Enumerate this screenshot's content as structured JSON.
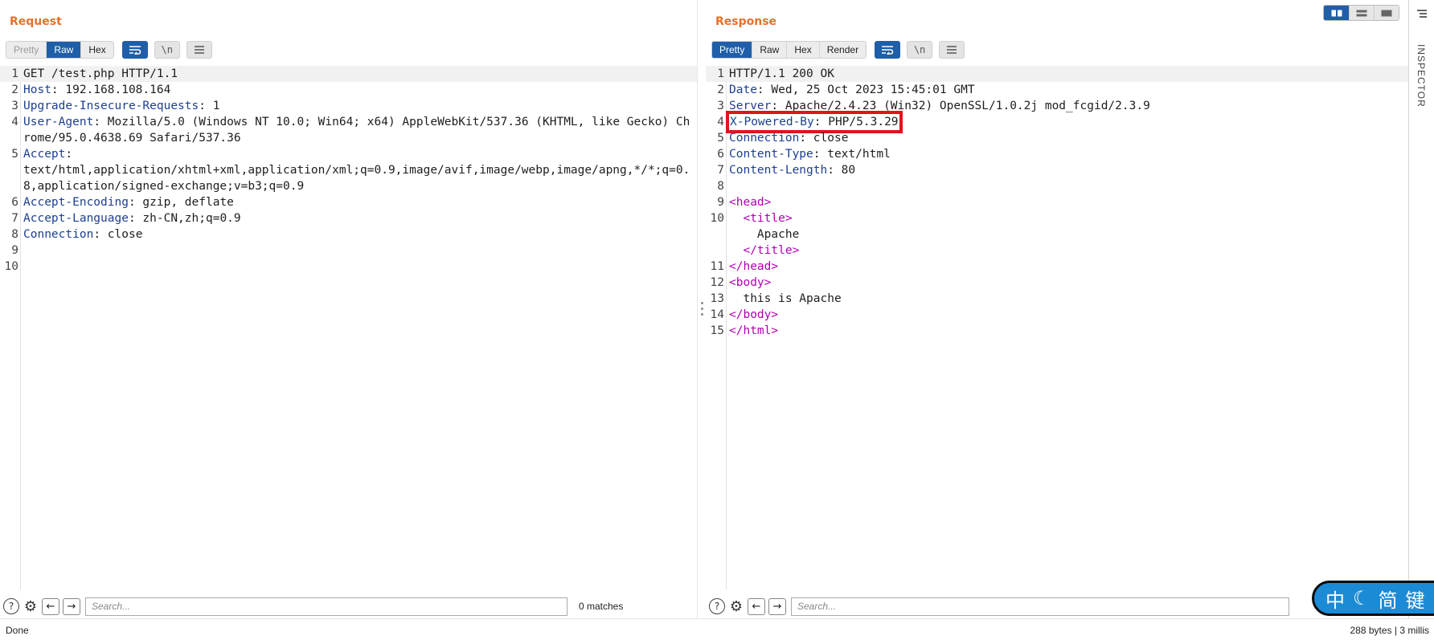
{
  "request": {
    "title": "Request",
    "tabs": [
      "Pretty",
      "Raw",
      "Hex"
    ],
    "newline_label": "\\n",
    "lines": [
      {
        "n": "1",
        "key": "",
        "val": "GET /test.php HTTP/1.1"
      },
      {
        "n": "2",
        "key": "Host",
        "val": ": 192.168.108.164"
      },
      {
        "n": "3",
        "key": "Upgrade-Insecure-Requests",
        "val": ": 1"
      },
      {
        "n": "4",
        "key": "User-Agent",
        "val": ": Mozilla/5.0 (Windows NT 10.0; Win64; x64) AppleWebKit/537.36 (KHTML, like Gecko) Chrome/95.0.4638.69 Safari/537.36"
      },
      {
        "n": "5",
        "key": "Accept",
        "val": ":\ntext/html,application/xhtml+xml,application/xml;q=0.9,image/avif,image/webp,image/apng,*/*;q=0.8,application/signed-exchange;v=b3;q=0.9"
      },
      {
        "n": "6",
        "key": "Accept-Encoding",
        "val": ": gzip, deflate"
      },
      {
        "n": "7",
        "key": "Accept-Language",
        "val": ": zh-CN,zh;q=0.9"
      },
      {
        "n": "8",
        "key": "Connection",
        "val": ": close"
      },
      {
        "n": "9",
        "key": "",
        "val": ""
      },
      {
        "n": "10",
        "key": "",
        "val": ""
      }
    ],
    "search_placeholder": "Search...",
    "matches": "0 matches"
  },
  "response": {
    "title": "Response",
    "tabs": [
      "Pretty",
      "Raw",
      "Hex",
      "Render"
    ],
    "newline_label": "\\n",
    "status_line": "HTTP/1.1 200 OK",
    "headers": [
      {
        "n": "2",
        "key": "Date",
        "val": ": Wed, 25 Oct 2023 15:45:01 GMT"
      },
      {
        "n": "3",
        "key": "Server",
        "val": ": Apache/2.4.23 (Win32) OpenSSL/1.0.2j mod_fcgid/2.3.9"
      },
      {
        "n": "4",
        "key": "X-Powered-By",
        "val": ": PHP/5.3.29"
      },
      {
        "n": "5",
        "key": "Connection",
        "val": ": close"
      },
      {
        "n": "6",
        "key": "Content-Type",
        "val": ": text/html"
      },
      {
        "n": "7",
        "key": "Content-Length",
        "val": ": 80"
      }
    ],
    "body": {
      "head_open": "<head>",
      "title_open": "<title>",
      "title_text": "Apache",
      "title_close": "</title>",
      "head_close": "</head>",
      "body_open": "<body>",
      "body_text": "this is Apache",
      "body_close": "</body>",
      "html_close": "</html>"
    },
    "line_numbers": [
      "1",
      "2",
      "3",
      "4",
      "5",
      "6",
      "7",
      "8",
      "9",
      "10",
      "11",
      "12",
      "13",
      "14",
      "15"
    ],
    "search_placeholder": "Search..."
  },
  "inspector": {
    "label": "INSPECTOR"
  },
  "status": {
    "left": "Done",
    "right": "288 bytes | 3 millis"
  },
  "ime": {
    "chars": [
      "中",
      "☾",
      "简",
      "键"
    ]
  },
  "colors": {
    "accent_blue": "#1f5ea8",
    "title_orange": "#e8702a",
    "header_key": "#1d3f8f",
    "tag_purple": "#b000b0",
    "highlight_red": "#e0141b"
  },
  "icons": [
    "help-icon",
    "gear-icon",
    "arrow-left-icon",
    "arrow-right-icon",
    "word-wrap-icon",
    "menu-icon",
    "layout-split-icon",
    "layout-horizontal-icon",
    "layout-single-icon"
  ]
}
